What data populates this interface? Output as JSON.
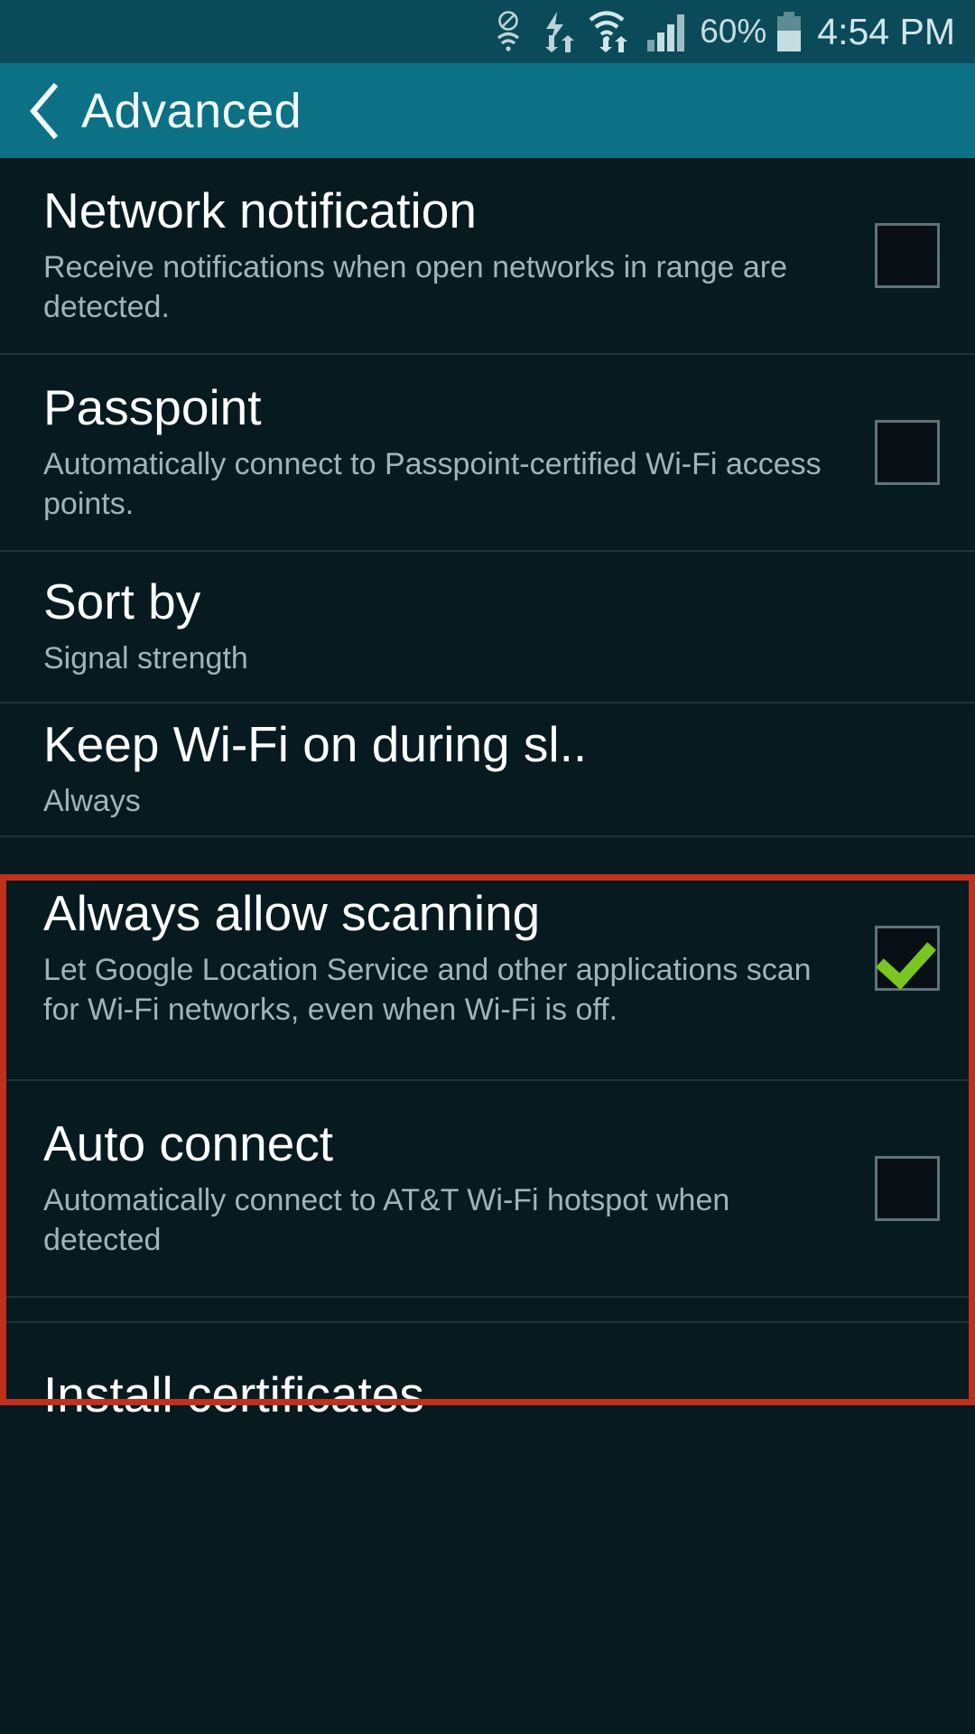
{
  "status_bar": {
    "icons": [
      "no-wifi-icon",
      "data-transfer-icon",
      "wifi-signal-icon",
      "cellular-signal-icon"
    ],
    "battery_percent": "60%",
    "battery_level": 60,
    "battery_icon": "battery-icon",
    "time": "4:54 PM"
  },
  "header": {
    "back_icon": "back-chevron-icon",
    "title": "Advanced"
  },
  "settings": {
    "rows": [
      {
        "title": "Network notification",
        "subtitle": "Receive notifications when open networks in range are detected.",
        "control": "checkbox",
        "checked": false
      },
      {
        "title": "Passpoint",
        "subtitle": "Automatically connect to Passpoint-certified Wi-Fi access points.",
        "control": "checkbox",
        "checked": false
      },
      {
        "title": "Sort by",
        "subtitle": "Signal strength",
        "control": "none",
        "checked": false
      },
      {
        "title": "Keep Wi-Fi on during sl..",
        "subtitle": "Always",
        "control": "none",
        "checked": false
      },
      {
        "title": "Always allow scanning",
        "subtitle": "Let Google Location Service and other applications scan for Wi-Fi networks, even when Wi-Fi is off.",
        "control": "checkbox",
        "checked": true
      },
      {
        "title": "Auto connect",
        "subtitle": "Automatically connect to AT&T Wi-Fi hotspot when detected",
        "control": "checkbox",
        "checked": false
      },
      {
        "title": "Install certificates",
        "subtitle": "",
        "control": "none",
        "checked": false
      }
    ]
  },
  "highlight": {
    "color": "#c1301b",
    "covers": [
      "Keep Wi-Fi on during sl..",
      "Always allow scanning"
    ]
  },
  "colors": {
    "status_bar_bg": "#0b4b59",
    "header_bg": "#0d7186",
    "content_bg": "#071a20",
    "title_text": "#fdfefe",
    "subtitle_text": "#9fb4bb",
    "check_green": "#79c623",
    "highlight_red": "#c1301b"
  }
}
